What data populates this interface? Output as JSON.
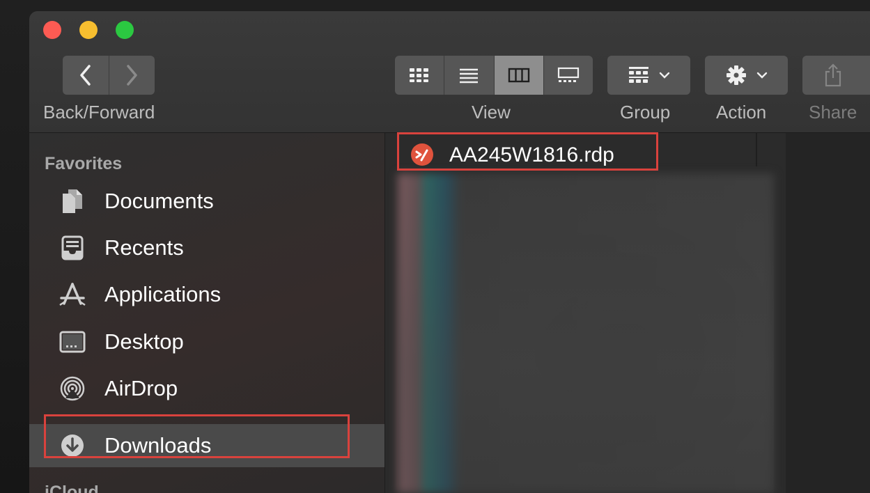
{
  "toolbar": {
    "back_forward_label": "Back/Forward",
    "view_label": "View",
    "group_label": "Group",
    "action_label": "Action",
    "share_label": "Share",
    "view_modes": [
      "icon-view",
      "list-view",
      "column-view",
      "gallery-view"
    ],
    "active_view": "column-view"
  },
  "sidebar": {
    "favorites_header": "Favorites",
    "items": [
      {
        "label": "Documents",
        "icon": "documents-icon"
      },
      {
        "label": "Recents",
        "icon": "recents-icon"
      },
      {
        "label": "Applications",
        "icon": "applications-icon"
      },
      {
        "label": "Desktop",
        "icon": "desktop-icon"
      },
      {
        "label": "AirDrop",
        "icon": "airdrop-icon"
      },
      {
        "label": "Downloads",
        "icon": "downloads-icon",
        "selected": true
      }
    ],
    "icloud_header": "iCloud"
  },
  "content": {
    "files": [
      {
        "name": "AA245W1816.rdp",
        "icon": "remote-desktop-file-icon"
      }
    ]
  },
  "highlight_color": "#d9423d"
}
